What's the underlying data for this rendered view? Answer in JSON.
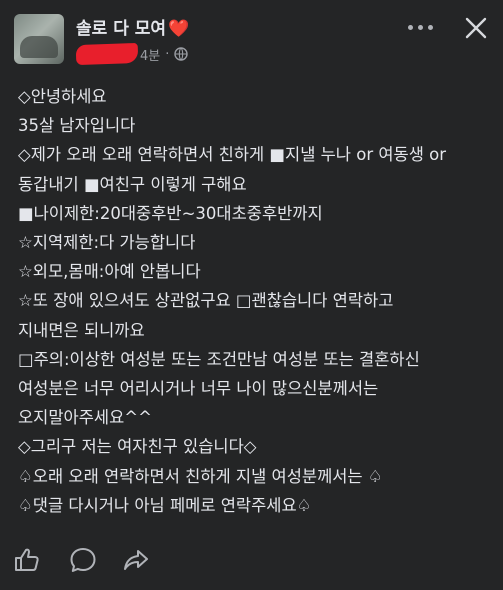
{
  "post": {
    "author_name": "솔로 다 모여",
    "author_emoji": "❤️",
    "time": "4분",
    "dot": "·",
    "lines": [
      "◇안녕하세요",
      "35살 남자입니다",
      "◇제가 오래 오래 연락하면서 친하게 ■지낼 누나 or 여동생 or",
      "동갑내기 ■여친구 이렇게 구해요",
      "■나이제한:20대중후반~30대초중후반까지",
      "☆지역제한:다 가능합니다",
      "☆외모,몸매:아예 안봅니다",
      "☆또 장애 있으셔도 상관없구요 □괜찮습니다 연락하고",
      "지내면은 되니까요",
      "□주의:이상한 여성분 또는 조건만남 여성분 또는 결혼하신",
      "여성분은 너무 어리시거나 너무 나이 많으신분께서는",
      "오지말아주세요^^",
      "◇그리구 저는 여자친구 있습니다◇",
      "♤오래 오래 연락하면서 친하게 지낼 여성분께서는 ♤",
      "♤댓글 다시거나 아님 페메로 연락주세요♤"
    ]
  },
  "icons": {
    "header": [
      "globe-icon",
      "more-icon",
      "close-icon"
    ],
    "actions": [
      "like-icon",
      "comment-icon",
      "share-icon"
    ]
  },
  "colors": {
    "background": "#242526",
    "text": "#e4e6eb",
    "secondary_text": "#9a9da3",
    "redaction": "#e81f2c",
    "heart": "#e53935"
  }
}
